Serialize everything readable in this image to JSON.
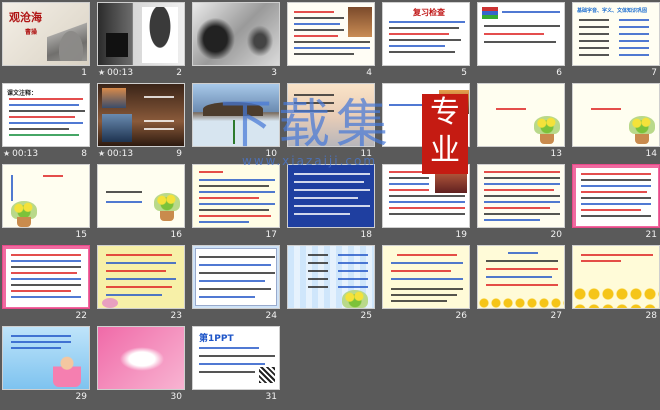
{
  "app": "slide-sorter",
  "slides": [
    {
      "number": "1",
      "timing": "",
      "title": "观沧海",
      "subtitle": "曹操"
    },
    {
      "number": "2",
      "timing": "00:13",
      "title": "",
      "subtitle": ""
    },
    {
      "number": "3",
      "timing": "",
      "title": "",
      "subtitle": ""
    },
    {
      "number": "4",
      "timing": "",
      "title": "",
      "subtitle": ""
    },
    {
      "number": "5",
      "timing": "",
      "title": "复习检查",
      "subtitle": ""
    },
    {
      "number": "6",
      "timing": "",
      "title": "",
      "subtitle": ""
    },
    {
      "number": "7",
      "timing": "",
      "title": "基础字音、字义、文体知识巩固",
      "subtitle": ""
    },
    {
      "number": "8",
      "timing": "00:13",
      "title": "课文注释：",
      "subtitle": ""
    },
    {
      "number": "9",
      "timing": "00:13",
      "title": "",
      "subtitle": ""
    },
    {
      "number": "10",
      "timing": "",
      "title": "",
      "subtitle": ""
    },
    {
      "number": "11",
      "timing": "",
      "title": "",
      "subtitle": ""
    },
    {
      "number": "12",
      "timing": "",
      "title": "",
      "subtitle": ""
    },
    {
      "number": "13",
      "timing": "",
      "title": "",
      "subtitle": ""
    },
    {
      "number": "14",
      "timing": "",
      "title": "",
      "subtitle": ""
    },
    {
      "number": "15",
      "timing": "",
      "title": "",
      "subtitle": ""
    },
    {
      "number": "16",
      "timing": "",
      "title": "",
      "subtitle": ""
    },
    {
      "number": "17",
      "timing": "",
      "title": "",
      "subtitle": ""
    },
    {
      "number": "18",
      "timing": "",
      "title": "",
      "subtitle": ""
    },
    {
      "number": "19",
      "timing": "",
      "title": "",
      "subtitle": ""
    },
    {
      "number": "20",
      "timing": "",
      "title": "",
      "subtitle": ""
    },
    {
      "number": "21",
      "timing": "",
      "title": "",
      "subtitle": ""
    },
    {
      "number": "22",
      "timing": "",
      "title": "",
      "subtitle": ""
    },
    {
      "number": "23",
      "timing": "",
      "title": "",
      "subtitle": ""
    },
    {
      "number": "24",
      "timing": "",
      "title": "",
      "subtitle": ""
    },
    {
      "number": "25",
      "timing": "",
      "title": "",
      "subtitle": ""
    },
    {
      "number": "26",
      "timing": "",
      "title": "",
      "subtitle": ""
    },
    {
      "number": "27",
      "timing": "",
      "title": "",
      "subtitle": ""
    },
    {
      "number": "28",
      "timing": "",
      "title": "",
      "subtitle": ""
    },
    {
      "number": "29",
      "timing": "",
      "title": "",
      "subtitle": ""
    },
    {
      "number": "30",
      "timing": "",
      "title": "",
      "subtitle": ""
    },
    {
      "number": "31",
      "timing": "",
      "title": "第1PPT",
      "subtitle": ""
    }
  ],
  "watermark": {
    "title": "下载集",
    "badge": "专业",
    "url": "www.xiazaiji.com"
  },
  "icons": {
    "timing": "star-icon"
  },
  "colors": {
    "background": "#5a5a5a",
    "thumb_border": "#cfcfcf",
    "meta_text": "#f2f2f2",
    "watermark_red": "#c51b12",
    "watermark_blue": "#4678d7"
  }
}
